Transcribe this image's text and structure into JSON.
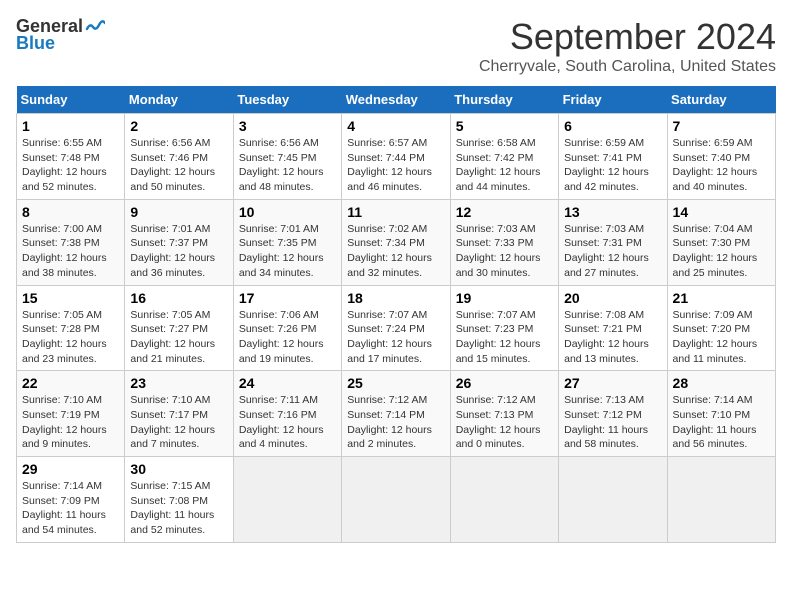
{
  "logo": {
    "line1": "General",
    "line2": "Blue"
  },
  "title": "September 2024",
  "location": "Cherryvale, South Carolina, United States",
  "headers": [
    "Sunday",
    "Monday",
    "Tuesday",
    "Wednesday",
    "Thursday",
    "Friday",
    "Saturday"
  ],
  "weeks": [
    [
      {
        "day": "1",
        "info": "Sunrise: 6:55 AM\nSunset: 7:48 PM\nDaylight: 12 hours\nand 52 minutes."
      },
      {
        "day": "2",
        "info": "Sunrise: 6:56 AM\nSunset: 7:46 PM\nDaylight: 12 hours\nand 50 minutes."
      },
      {
        "day": "3",
        "info": "Sunrise: 6:56 AM\nSunset: 7:45 PM\nDaylight: 12 hours\nand 48 minutes."
      },
      {
        "day": "4",
        "info": "Sunrise: 6:57 AM\nSunset: 7:44 PM\nDaylight: 12 hours\nand 46 minutes."
      },
      {
        "day": "5",
        "info": "Sunrise: 6:58 AM\nSunset: 7:42 PM\nDaylight: 12 hours\nand 44 minutes."
      },
      {
        "day": "6",
        "info": "Sunrise: 6:59 AM\nSunset: 7:41 PM\nDaylight: 12 hours\nand 42 minutes."
      },
      {
        "day": "7",
        "info": "Sunrise: 6:59 AM\nSunset: 7:40 PM\nDaylight: 12 hours\nand 40 minutes."
      }
    ],
    [
      {
        "day": "8",
        "info": "Sunrise: 7:00 AM\nSunset: 7:38 PM\nDaylight: 12 hours\nand 38 minutes."
      },
      {
        "day": "9",
        "info": "Sunrise: 7:01 AM\nSunset: 7:37 PM\nDaylight: 12 hours\nand 36 minutes."
      },
      {
        "day": "10",
        "info": "Sunrise: 7:01 AM\nSunset: 7:35 PM\nDaylight: 12 hours\nand 34 minutes."
      },
      {
        "day": "11",
        "info": "Sunrise: 7:02 AM\nSunset: 7:34 PM\nDaylight: 12 hours\nand 32 minutes."
      },
      {
        "day": "12",
        "info": "Sunrise: 7:03 AM\nSunset: 7:33 PM\nDaylight: 12 hours\nand 30 minutes."
      },
      {
        "day": "13",
        "info": "Sunrise: 7:03 AM\nSunset: 7:31 PM\nDaylight: 12 hours\nand 27 minutes."
      },
      {
        "day": "14",
        "info": "Sunrise: 7:04 AM\nSunset: 7:30 PM\nDaylight: 12 hours\nand 25 minutes."
      }
    ],
    [
      {
        "day": "15",
        "info": "Sunrise: 7:05 AM\nSunset: 7:28 PM\nDaylight: 12 hours\nand 23 minutes."
      },
      {
        "day": "16",
        "info": "Sunrise: 7:05 AM\nSunset: 7:27 PM\nDaylight: 12 hours\nand 21 minutes."
      },
      {
        "day": "17",
        "info": "Sunrise: 7:06 AM\nSunset: 7:26 PM\nDaylight: 12 hours\nand 19 minutes."
      },
      {
        "day": "18",
        "info": "Sunrise: 7:07 AM\nSunset: 7:24 PM\nDaylight: 12 hours\nand 17 minutes."
      },
      {
        "day": "19",
        "info": "Sunrise: 7:07 AM\nSunset: 7:23 PM\nDaylight: 12 hours\nand 15 minutes."
      },
      {
        "day": "20",
        "info": "Sunrise: 7:08 AM\nSunset: 7:21 PM\nDaylight: 12 hours\nand 13 minutes."
      },
      {
        "day": "21",
        "info": "Sunrise: 7:09 AM\nSunset: 7:20 PM\nDaylight: 12 hours\nand 11 minutes."
      }
    ],
    [
      {
        "day": "22",
        "info": "Sunrise: 7:10 AM\nSunset: 7:19 PM\nDaylight: 12 hours\nand 9 minutes."
      },
      {
        "day": "23",
        "info": "Sunrise: 7:10 AM\nSunset: 7:17 PM\nDaylight: 12 hours\nand 7 minutes."
      },
      {
        "day": "24",
        "info": "Sunrise: 7:11 AM\nSunset: 7:16 PM\nDaylight: 12 hours\nand 4 minutes."
      },
      {
        "day": "25",
        "info": "Sunrise: 7:12 AM\nSunset: 7:14 PM\nDaylight: 12 hours\nand 2 minutes."
      },
      {
        "day": "26",
        "info": "Sunrise: 7:12 AM\nSunset: 7:13 PM\nDaylight: 12 hours\nand 0 minutes."
      },
      {
        "day": "27",
        "info": "Sunrise: 7:13 AM\nSunset: 7:12 PM\nDaylight: 11 hours\nand 58 minutes."
      },
      {
        "day": "28",
        "info": "Sunrise: 7:14 AM\nSunset: 7:10 PM\nDaylight: 11 hours\nand 56 minutes."
      }
    ],
    [
      {
        "day": "29",
        "info": "Sunrise: 7:14 AM\nSunset: 7:09 PM\nDaylight: 11 hours\nand 54 minutes."
      },
      {
        "day": "30",
        "info": "Sunrise: 7:15 AM\nSunset: 7:08 PM\nDaylight: 11 hours\nand 52 minutes."
      },
      {
        "day": "",
        "info": ""
      },
      {
        "day": "",
        "info": ""
      },
      {
        "day": "",
        "info": ""
      },
      {
        "day": "",
        "info": ""
      },
      {
        "day": "",
        "info": ""
      }
    ]
  ]
}
